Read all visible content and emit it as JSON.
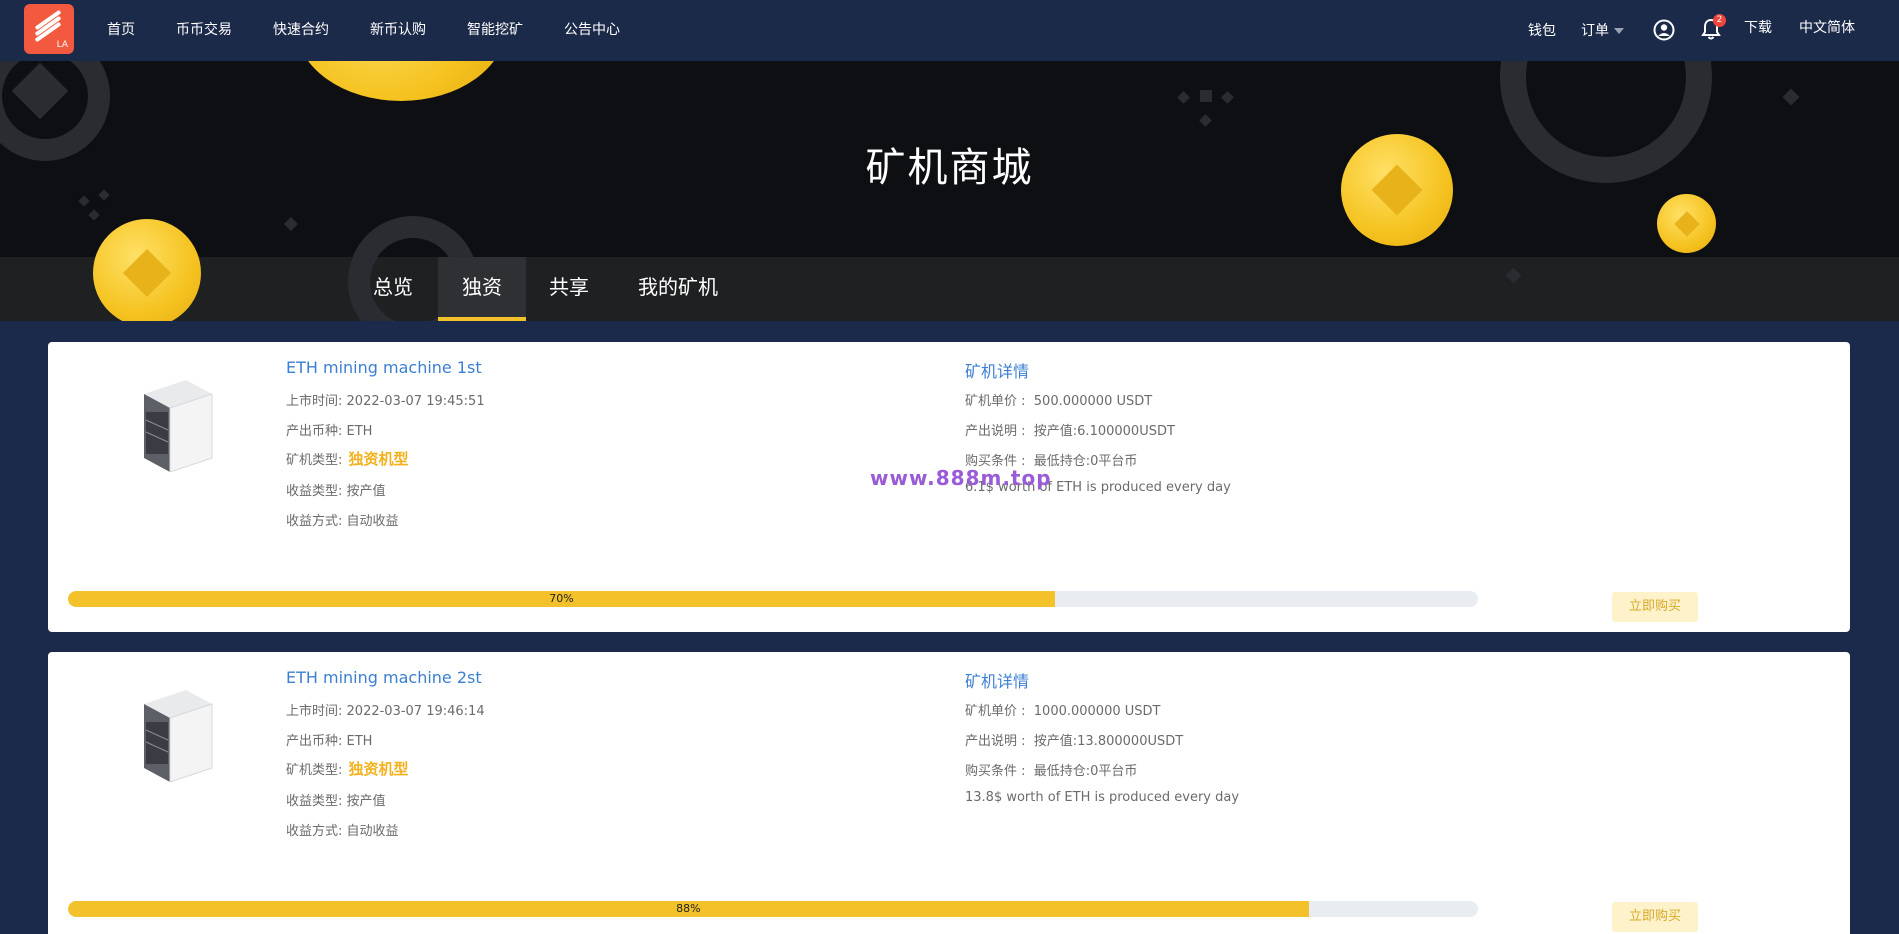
{
  "nav": {
    "logo_text": "LA",
    "items": [
      "首页",
      "币币交易",
      "快速合约",
      "新币认购",
      "智能挖矿",
      "公告中心"
    ],
    "wallet": "钱包",
    "orders": "订单",
    "notification_count": "2",
    "download": "下载",
    "language": "中文简体"
  },
  "banner": {
    "title": "矿机商城"
  },
  "tabs": [
    "总览",
    "独资",
    "共享",
    "我的矿机"
  ],
  "active_tab": "独资",
  "watermark": "www.888m.top",
  "machines": [
    {
      "name": "ETH mining machine 1st",
      "listed_label": "上市时间:",
      "listed": "2022-03-07 19:45:51",
      "coin_label": "产出币种:",
      "coin": "ETH",
      "type_label": "矿机类型:",
      "type": "独资机型",
      "income_type_label": "收益类型:",
      "income_type": "按产值",
      "income_mode_label": "收益方式:",
      "income_mode": "自动收益",
      "detail_title": "矿机详情",
      "price_label": "矿机单价 :",
      "price": "500.000000 USDT",
      "output_label": "产出说明 :",
      "output": "按产值:6.100000USDT",
      "condition_label": "购买条件 :",
      "condition": "最低持仓:0平台币",
      "note": "6.1$ worth of ETH is produced every day",
      "progress": 70,
      "progress_label": "70%",
      "buy": "立即购买"
    },
    {
      "name": "ETH mining machine 2st",
      "listed_label": "上市时间:",
      "listed": "2022-03-07 19:46:14",
      "coin_label": "产出币种:",
      "coin": "ETH",
      "type_label": "矿机类型:",
      "type": "独资机型",
      "income_type_label": "收益类型:",
      "income_type": "按产值",
      "income_mode_label": "收益方式:",
      "income_mode": "自动收益",
      "detail_title": "矿机详情",
      "price_label": "矿机单价 :",
      "price": "1000.000000 USDT",
      "output_label": "产出说明 :",
      "output": "按产值:13.800000USDT",
      "condition_label": "购买条件 :",
      "condition": "最低持仓:0平台币",
      "note": "13.8$ worth of ETH is produced every day",
      "progress": 88,
      "progress_label": "88%",
      "buy": "立即购买"
    }
  ]
}
